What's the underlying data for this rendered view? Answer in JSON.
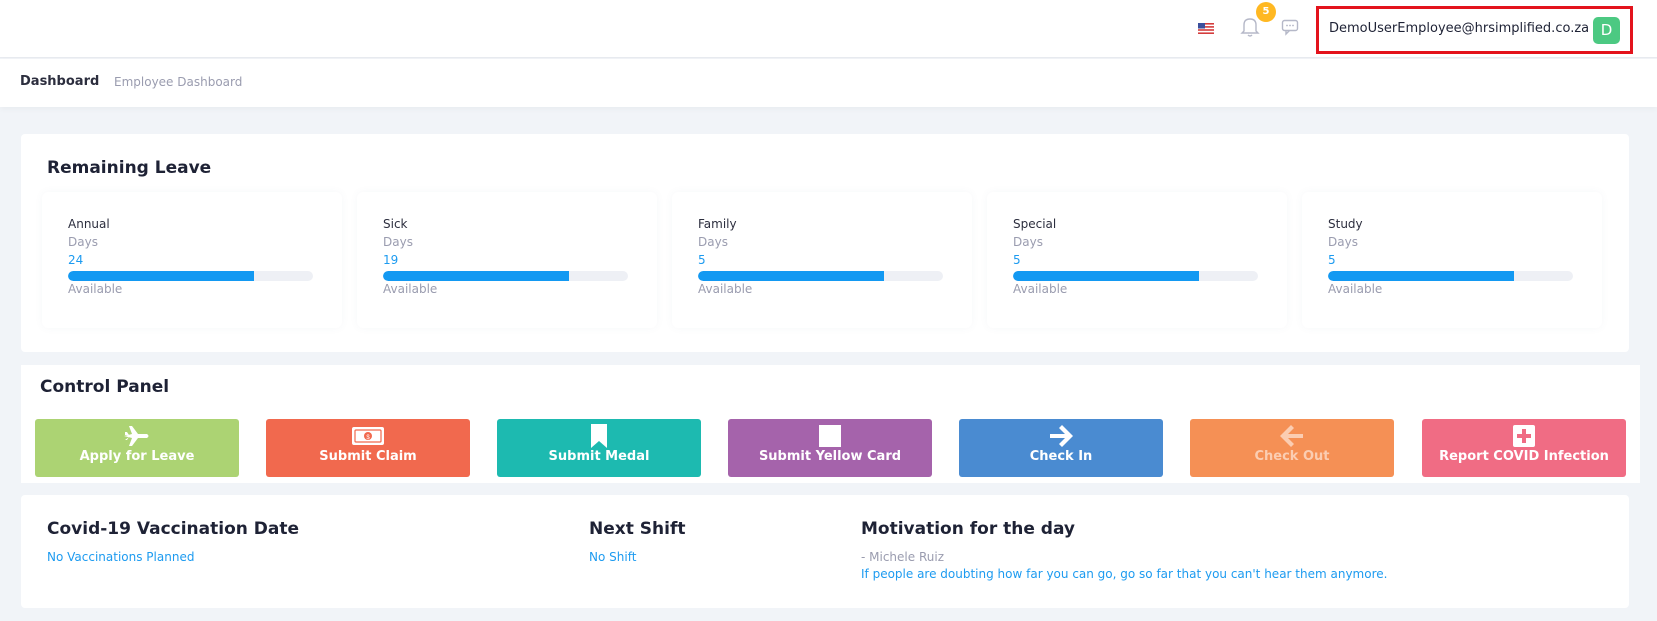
{
  "topbar": {
    "flag_icon": "us-flag-icon",
    "notification_count": "5",
    "user_email": "DemoUserEmployee@hrsimplified.co.za",
    "avatar_letter": "D"
  },
  "subheader": {
    "title": "Dashboard",
    "breadcrumb": "Employee Dashboard"
  },
  "remaining_leave": {
    "title": "Remaining Leave",
    "items": [
      {
        "name": "Annual",
        "unit": "Days",
        "value": "24",
        "status": "Available",
        "progress": 0.76
      },
      {
        "name": "Sick",
        "unit": "Days",
        "value": "19",
        "status": "Available",
        "progress": 0.76
      },
      {
        "name": "Family",
        "unit": "Days",
        "value": "5",
        "status": "Available",
        "progress": 0.76
      },
      {
        "name": "Special",
        "unit": "Days",
        "value": "5",
        "status": "Available",
        "progress": 0.76
      },
      {
        "name": "Study",
        "unit": "Days",
        "value": "5",
        "status": "Available",
        "progress": 0.76
      }
    ]
  },
  "control_panel": {
    "title": "Control Panel",
    "buttons": [
      {
        "label": "Apply for Leave",
        "icon": "airplane-icon",
        "color": "#acd373"
      },
      {
        "label": "Submit Claim",
        "icon": "money-icon",
        "color": "#f1694e"
      },
      {
        "label": "Submit Medal",
        "icon": "bookmark-icon",
        "color": "#1dbab0"
      },
      {
        "label": "Submit Yellow Card",
        "icon": "card-icon",
        "color": "#a563ab"
      },
      {
        "label": "Check In",
        "icon": "arrow-right-icon",
        "color": "#4a8bd1"
      },
      {
        "label": "Check Out",
        "icon": "arrow-left-icon",
        "color": "#f59055"
      },
      {
        "label": "Report COVID Infection",
        "icon": "medical-cross-icon",
        "color": "#f06c84"
      }
    ]
  },
  "info": {
    "vaccination": {
      "title": "Covid-19 Vaccination Date",
      "value": "No Vaccinations Planned"
    },
    "next_shift": {
      "title": "Next Shift",
      "value": "No Shift"
    },
    "motivation": {
      "title": "Motivation for the day",
      "author": "- Michele Ruiz",
      "quote": "If people are doubting how far you can go, go so far that you can't hear them anymore."
    }
  }
}
